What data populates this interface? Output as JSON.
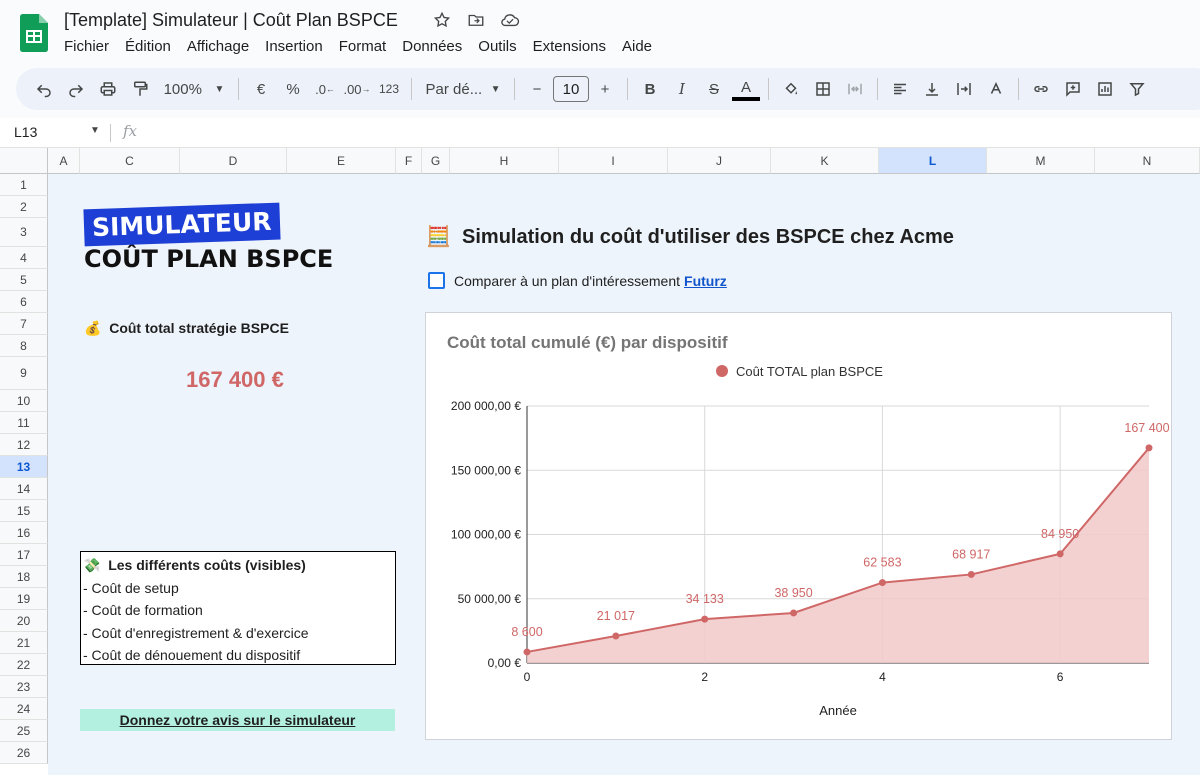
{
  "document": {
    "title": "[Template] Simulateur | Coût Plan BSPCE"
  },
  "menu": [
    "Fichier",
    "Édition",
    "Affichage",
    "Insertion",
    "Format",
    "Données",
    "Outils",
    "Extensions",
    "Aide"
  ],
  "toolbar": {
    "zoom": "100%",
    "currency": "€",
    "percent": "%",
    "decrease_decimals": ".0",
    "increase_decimals": ".00",
    "number_format": "123",
    "font": "Par dé...",
    "font_size": "10",
    "bold": "B",
    "italic": "I",
    "strike": "S",
    "text_color": "A"
  },
  "formula_bar": {
    "cell_ref": "L13",
    "fx": "fx"
  },
  "columns": [
    "A",
    "C",
    "D",
    "E",
    "F",
    "G",
    "H",
    "I",
    "J",
    "K",
    "L",
    "M",
    "N"
  ],
  "selected_column": "L",
  "rows": [
    "1",
    "2",
    "3",
    "4",
    "5",
    "6",
    "7",
    "8",
    "9",
    "10",
    "11",
    "12",
    "13",
    "14",
    "15",
    "16",
    "17",
    "18",
    "19",
    "20",
    "21",
    "22",
    "23",
    "24",
    "25",
    "26"
  ],
  "selected_row": "13",
  "sheet": {
    "logo_top": "SIMULATEUR",
    "logo_bottom": "COÛT PLAN BSPCE",
    "cost_icon": "💰",
    "cost_label": "Coût total stratégie BSPCE",
    "cost_value": "167 400 €",
    "costs_icon": "💸",
    "costs_header": "Les différents coûts (visibles)",
    "costs_items": [
      "- Coût de setup",
      "- Coût de formation",
      "- Coût d'enregistrement & d'exercice",
      "- Coût de dénouement du dispositif"
    ],
    "feedback_link": "Donnez votre avis sur le simulateur",
    "sim_icon": "🧮",
    "sim_title": "Simulation du coût d'utiliser des BSPCE chez Acme",
    "compare_text": "Comparer à un plan d'intéressement",
    "compare_link": "Futurz"
  },
  "chart_data": {
    "type": "area",
    "title": "Coût total cumulé (€) par dispositif",
    "xlabel": "Année",
    "ylabel": "",
    "legend_position": "top",
    "x": [
      0,
      1,
      2,
      3,
      4,
      5,
      6,
      7
    ],
    "x_ticks": [
      "0",
      "2",
      "4",
      "6"
    ],
    "y_ticks": [
      "0,00 €",
      "50 000,00 €",
      "100 000,00 €",
      "150 000,00 €",
      "200 000,00 €"
    ],
    "ylim": [
      0,
      200000
    ],
    "xlim": [
      0,
      7
    ],
    "grid": true,
    "series": [
      {
        "name": "Coût TOTAL plan BSPCE",
        "color": "#d06767",
        "fill": "#f2c9c9",
        "values": [
          8600,
          21017,
          34133,
          38950,
          62583,
          68917,
          84950,
          167400
        ],
        "labels": [
          "8 600",
          "21 017",
          "34 133",
          "38 950",
          "62 583",
          "68 917",
          "84 950",
          "167 400"
        ]
      }
    ]
  }
}
